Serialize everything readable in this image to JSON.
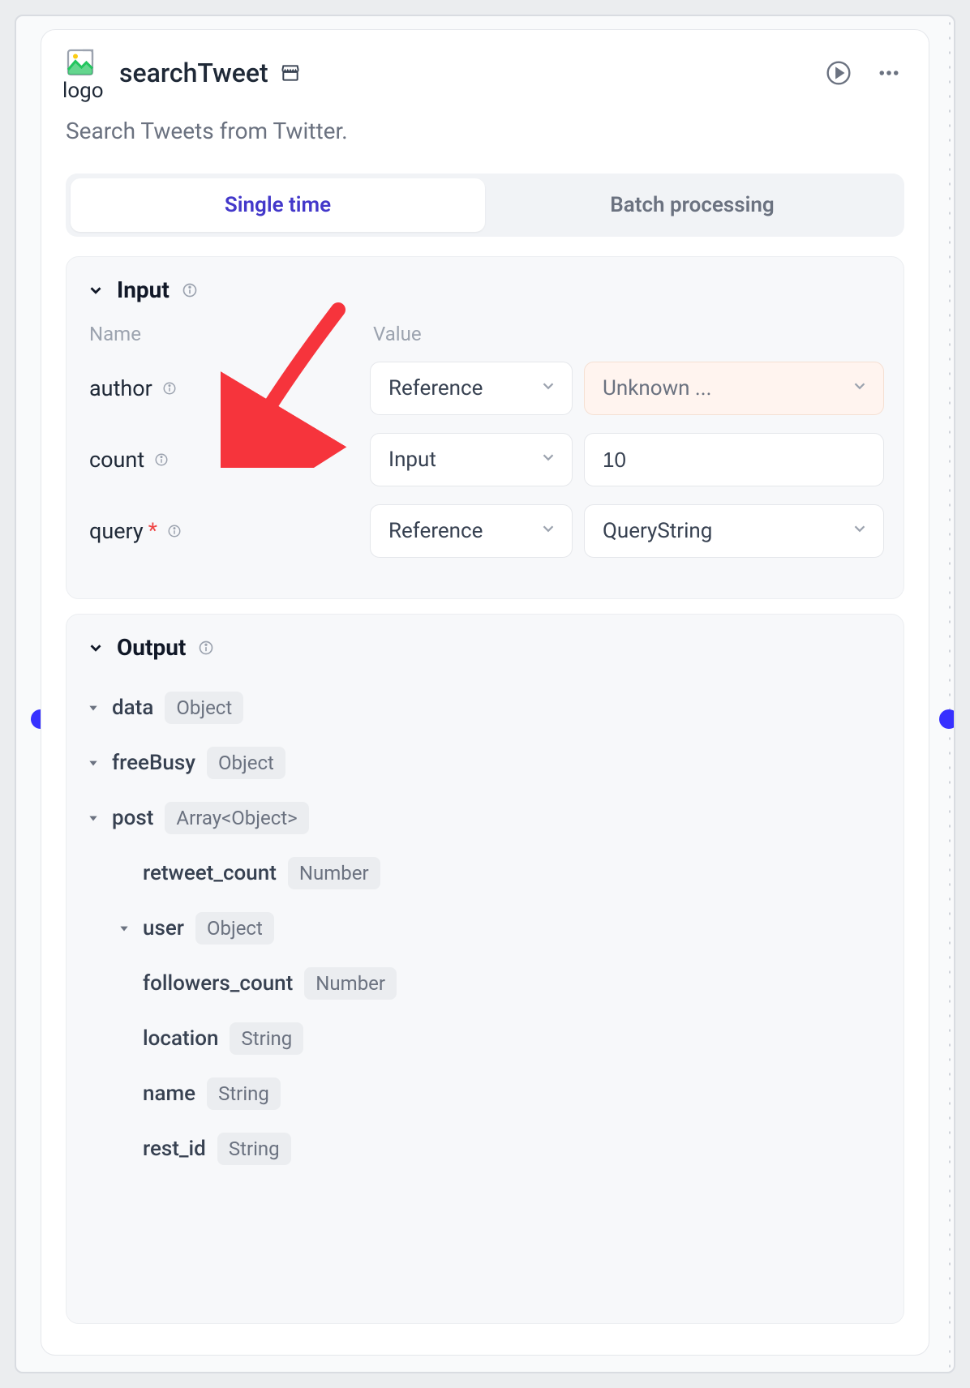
{
  "header": {
    "logo_alt": "logo",
    "title": "searchTweet",
    "store_icon": "store-icon",
    "run_icon": "play-icon",
    "more_icon": "more-icon"
  },
  "description": "Search Tweets from Twitter.",
  "tabs": {
    "single": "Single time",
    "batch": "Batch processing"
  },
  "input_section": {
    "title": "Input",
    "col_name": "Name",
    "col_value": "Value",
    "rows": [
      {
        "name": "author",
        "required": false,
        "mode": "Reference",
        "value": "Unknown ...",
        "warn": true
      },
      {
        "name": "count",
        "required": false,
        "mode": "Input",
        "value": "10",
        "warn": false
      },
      {
        "name": "query",
        "required": true,
        "mode": "Reference",
        "value": "QueryString",
        "warn": false
      }
    ]
  },
  "output_section": {
    "title": "Output",
    "tree": [
      {
        "name": "data",
        "type": "Object",
        "indent": 0,
        "caret": true
      },
      {
        "name": "freeBusy",
        "type": "Object",
        "indent": 0,
        "caret": true
      },
      {
        "name": "post",
        "type": "Array<Object>",
        "indent": 0,
        "caret": true
      },
      {
        "name": "retweet_count",
        "type": "Number",
        "indent": 1,
        "caret": false
      },
      {
        "name": "user",
        "type": "Object",
        "indent": 1,
        "caret": true
      },
      {
        "name": "followers_count",
        "type": "Number",
        "indent": 1,
        "caret": false
      },
      {
        "name": "location",
        "type": "String",
        "indent": 1,
        "caret": false
      },
      {
        "name": "name",
        "type": "String",
        "indent": 1,
        "caret": false
      },
      {
        "name": "rest_id",
        "type": "String",
        "indent": 1,
        "caret": false
      }
    ]
  }
}
